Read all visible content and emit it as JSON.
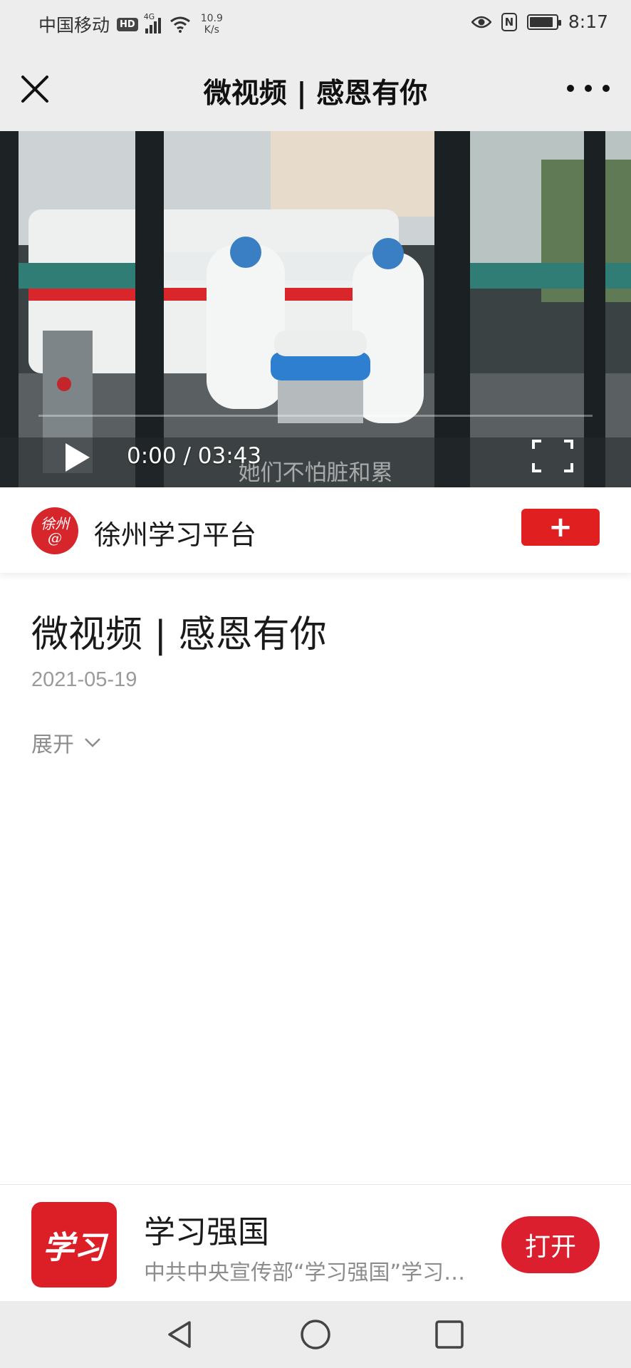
{
  "status_bar": {
    "carrier": "中国移动",
    "hd": "HD",
    "network_type": "4G",
    "speed_value": "10.9",
    "speed_unit": "K/s",
    "time": "8:17",
    "nfc": "N",
    "battery_level": 0.9
  },
  "header": {
    "title": "微视频 | 感恩有你",
    "close_icon": "close-icon",
    "more_icon": "more-icon"
  },
  "video": {
    "time_display": "0:00 / 03:43",
    "subtitle": "她们不怕脏和累",
    "progress": 0.0
  },
  "publisher": {
    "avatar_text_top": "徐州",
    "avatar_text_bottom": "@",
    "name": "徐州学习平台",
    "follow_label": "+"
  },
  "article": {
    "title": "微视频 | 感恩有你",
    "date": "2021-05-19",
    "expand_label": "展开"
  },
  "app_promo": {
    "logo_text": "学习",
    "title": "学习强国",
    "description": "中共中央宣传部“学习强国”学习平台",
    "open_label": "打开",
    "brand_color": "#dc1f2e"
  },
  "nav_bar": {
    "icons": [
      "back-icon",
      "home-icon",
      "recents-icon"
    ]
  }
}
